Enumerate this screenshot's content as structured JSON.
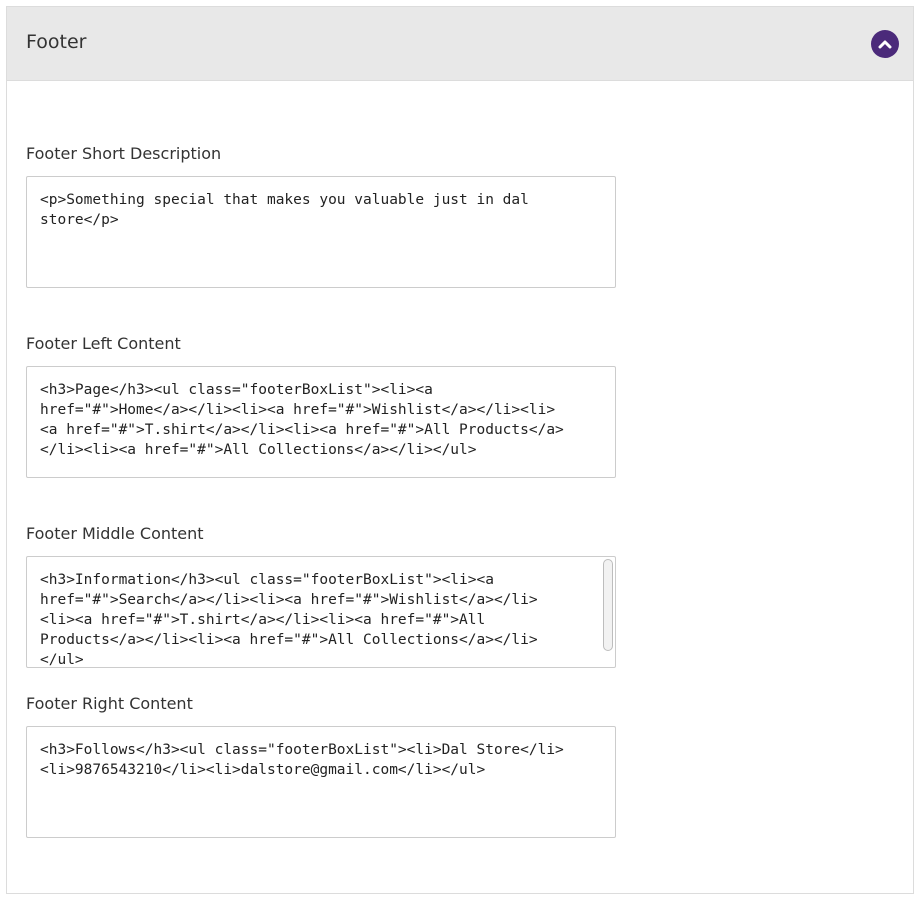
{
  "panel": {
    "title": "Footer",
    "toggle_icon": "chevron-up-icon",
    "accent_color": "#4b2a7a"
  },
  "fields": {
    "short_description": {
      "label": "Footer Short Description",
      "value": "<p>Something special that makes you valuable just in dal\nstore</p>"
    },
    "left_content": {
      "label": "Footer Left Content",
      "value": "<h3>Page</h3><ul class=\"footerBoxList\"><li><a\nhref=\"#\">Home</a></li><li><a href=\"#\">Wishlist</a></li><li>\n<a href=\"#\">T.shirt</a></li><li><a href=\"#\">All Products</a>\n</li><li><a href=\"#\">All Collections</a></li></ul>"
    },
    "middle_content": {
      "label": "Footer Middle Content",
      "value": "<h3>Information</h3><ul class=\"footerBoxList\"><li><a\nhref=\"#\">Search</a></li><li><a href=\"#\">Wishlist</a></li>\n<li><a href=\"#\">T.shirt</a></li><li><a href=\"#\">All\nProducts</a></li><li><a href=\"#\">All Collections</a></li>\n</ul>"
    },
    "right_content": {
      "label": "Footer Right Content",
      "value": "<h3>Follows</h3><ul class=\"footerBoxList\"><li>Dal Store</li>\n<li>9876543210</li><li>dalstore@gmail.com</li></ul>"
    }
  }
}
